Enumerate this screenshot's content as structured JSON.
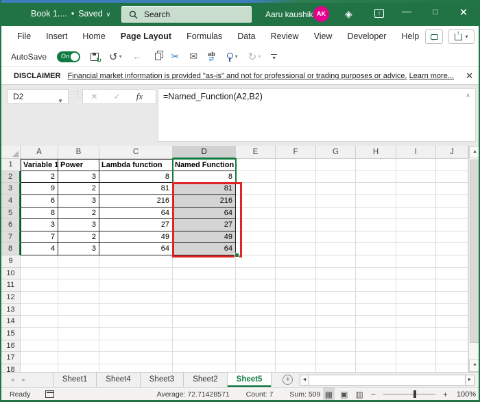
{
  "title_bar": {
    "doc_title": "Book 1....",
    "separator": "•",
    "saved_label": "Saved",
    "search_placeholder": "Search",
    "user_name": "Aaru kaushik",
    "user_initials": "AK"
  },
  "menu": {
    "items": [
      "File",
      "Insert",
      "Home",
      "Page Layout",
      "Formulas",
      "Data",
      "Review",
      "View",
      "Developer",
      "Help"
    ],
    "active": "Page Layout"
  },
  "qat": {
    "autosave_label": "AutoSave",
    "autosave_state": "On",
    "icons": [
      "save-icon",
      "undo-icon",
      "back-icon",
      "copy-icon",
      "cut-icon",
      "mail-icon",
      "find-replace-icon",
      "touch-mode-icon",
      "redo-icon",
      "more-commands-icon"
    ]
  },
  "disclaimer": {
    "label": "DISCLAIMER",
    "text": "Financial market information is provided \"as-is\" and not for professional or trading purposes or advice.",
    "link_text": "Learn more..."
  },
  "formula_bar": {
    "name_box": "D2",
    "fx_label": "fx",
    "formula": "=Named_Function(A2,B2)"
  },
  "grid": {
    "column_headers": [
      "A",
      "B",
      "C",
      "D",
      "E",
      "F",
      "G",
      "H",
      "I",
      "J"
    ],
    "visible_rows": 18,
    "active_cell": "D2",
    "selection": "D2:D8",
    "table": {
      "headers": [
        "Variable 1",
        "Power",
        "Lambda function",
        "Named Function"
      ],
      "rows": [
        [
          2,
          3,
          8,
          8
        ],
        [
          9,
          2,
          81,
          81
        ],
        [
          6,
          3,
          216,
          216
        ],
        [
          8,
          2,
          64,
          64
        ],
        [
          3,
          3,
          27,
          27
        ],
        [
          7,
          2,
          49,
          49
        ],
        [
          4,
          3,
          64,
          64
        ]
      ]
    }
  },
  "sheet_tabs": {
    "tabs": [
      "Sheet1",
      "Sheet4",
      "Sheet3",
      "Sheet2",
      "Sheet5"
    ],
    "active": "Sheet5"
  },
  "status_bar": {
    "mode": "Ready",
    "average": "Average: 72.71428571",
    "count": "Count: 7",
    "sum": "Sum: 509",
    "zoom": "100%"
  },
  "colors": {
    "excel_green": "#217346",
    "accent_green": "#107c41",
    "selection_red": "#e02424",
    "avatar_pink": "#e3008c",
    "selection_gray": "#d4d4d4",
    "search_box_green": "#c9ddcf"
  }
}
